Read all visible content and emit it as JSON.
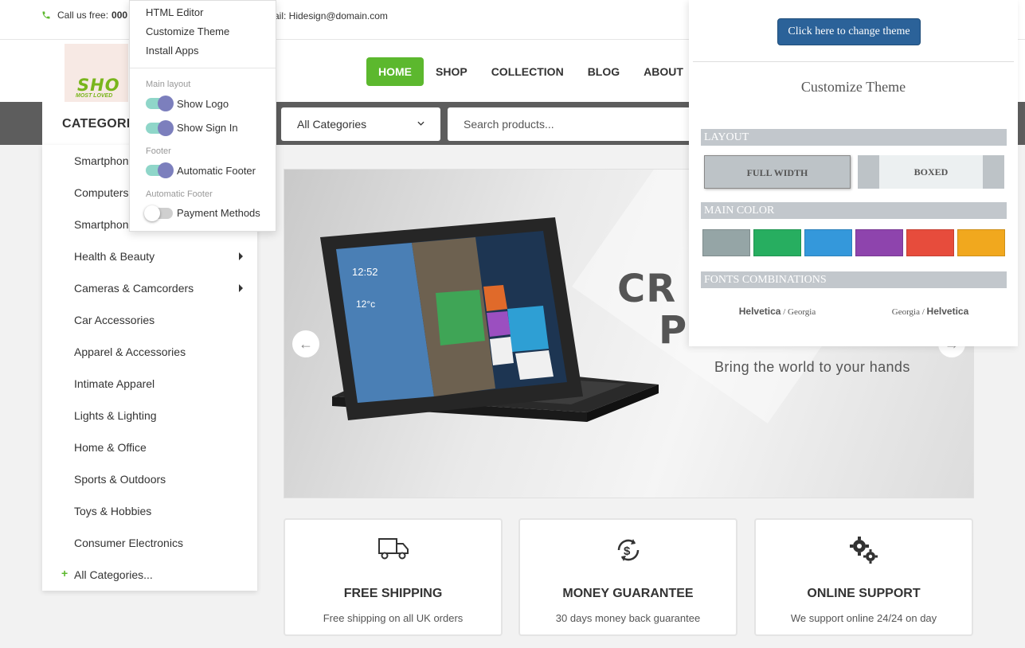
{
  "topbar": {
    "call_label": "Call us free:",
    "call_number": "000",
    "email": "ail: Hidesign@domain.com"
  },
  "logo": {
    "text": "SHO",
    "tagline": "MOST LOVED"
  },
  "nav": {
    "items": [
      "HOME",
      "SHOP",
      "COLLECTION",
      "BLOG",
      "ABOUT"
    ]
  },
  "search": {
    "categories_label": "CATEGORI",
    "category_select": "All Categories",
    "placeholder": "Search products..."
  },
  "categories": [
    {
      "label": "Smartphon",
      "arrow": false
    },
    {
      "label": "Computers",
      "arrow": false
    },
    {
      "label": "Smartphon",
      "arrow": false
    },
    {
      "label": "Health & Beauty",
      "arrow": true
    },
    {
      "label": "Cameras & Camcorders",
      "arrow": true
    },
    {
      "label": "Car Accessories",
      "arrow": false
    },
    {
      "label": "Apparel & Accessories",
      "arrow": false
    },
    {
      "label": "Intimate Apparel",
      "arrow": false
    },
    {
      "label": "Lights & Lighting",
      "arrow": false
    },
    {
      "label": "Home & Office",
      "arrow": false
    },
    {
      "label": "Sports & Outdoors",
      "arrow": false
    },
    {
      "label": "Toys & Hobbies",
      "arrow": false
    },
    {
      "label": "Consumer Electronics",
      "arrow": false
    }
  ],
  "all_categories": {
    "plus": "+",
    "label": "All Categories..."
  },
  "banner": {
    "headline_1": "CR",
    "headline_2": "P",
    "subtitle": "Bring the world to your hands",
    "prev": "←",
    "next": "→",
    "tablet_time": "12:52",
    "tablet_time2": "12°c"
  },
  "features": [
    {
      "icon": "truck-icon",
      "title": "FREE SHIPPING",
      "desc": "Free shipping on all UK orders"
    },
    {
      "icon": "money-refresh-icon",
      "title": "MONEY GUARANTEE",
      "desc": "30 days money back guarantee"
    },
    {
      "icon": "gears-icon",
      "title": "ONLINE SUPPORT",
      "desc": "We support online 24/24 on day"
    }
  ],
  "menu": {
    "items": [
      "HTML Editor",
      "Customize Theme",
      "Install Apps"
    ],
    "group_main": "Main layout",
    "show_logo": "Show Logo",
    "show_signin": "Show Sign In",
    "group_footer": "Footer",
    "auto_footer": "Automatic Footer",
    "group_auto_footer": "Automatic Footer",
    "payment": "Payment Methods",
    "toggles": {
      "show_logo": true,
      "show_signin": true,
      "auto_footer": true,
      "payment": false
    }
  },
  "theme_panel": {
    "change_button": "Click here to change theme",
    "title": "Customize Theme",
    "layout_section": "LAYOUT",
    "full_width": "FULL WIDTH",
    "boxed": "BOXED",
    "color_section": "MAIN COLOR",
    "colors": [
      "#95a5a6",
      "#27ae60",
      "#3498db",
      "#8e44ad",
      "#e74c3c",
      "#f1a81e"
    ],
    "fonts_section": "FONTS COMBINATIONS",
    "font_combo_1_a": "Helvetica",
    "font_combo_1_b": " / Georgia",
    "font_combo_2_a": "Georgia / ",
    "font_combo_2_b": "Helvetica"
  },
  "colors": {
    "accent": "#5cb82e",
    "band": "#5d5d5d",
    "theme_button": "#2b6299"
  }
}
